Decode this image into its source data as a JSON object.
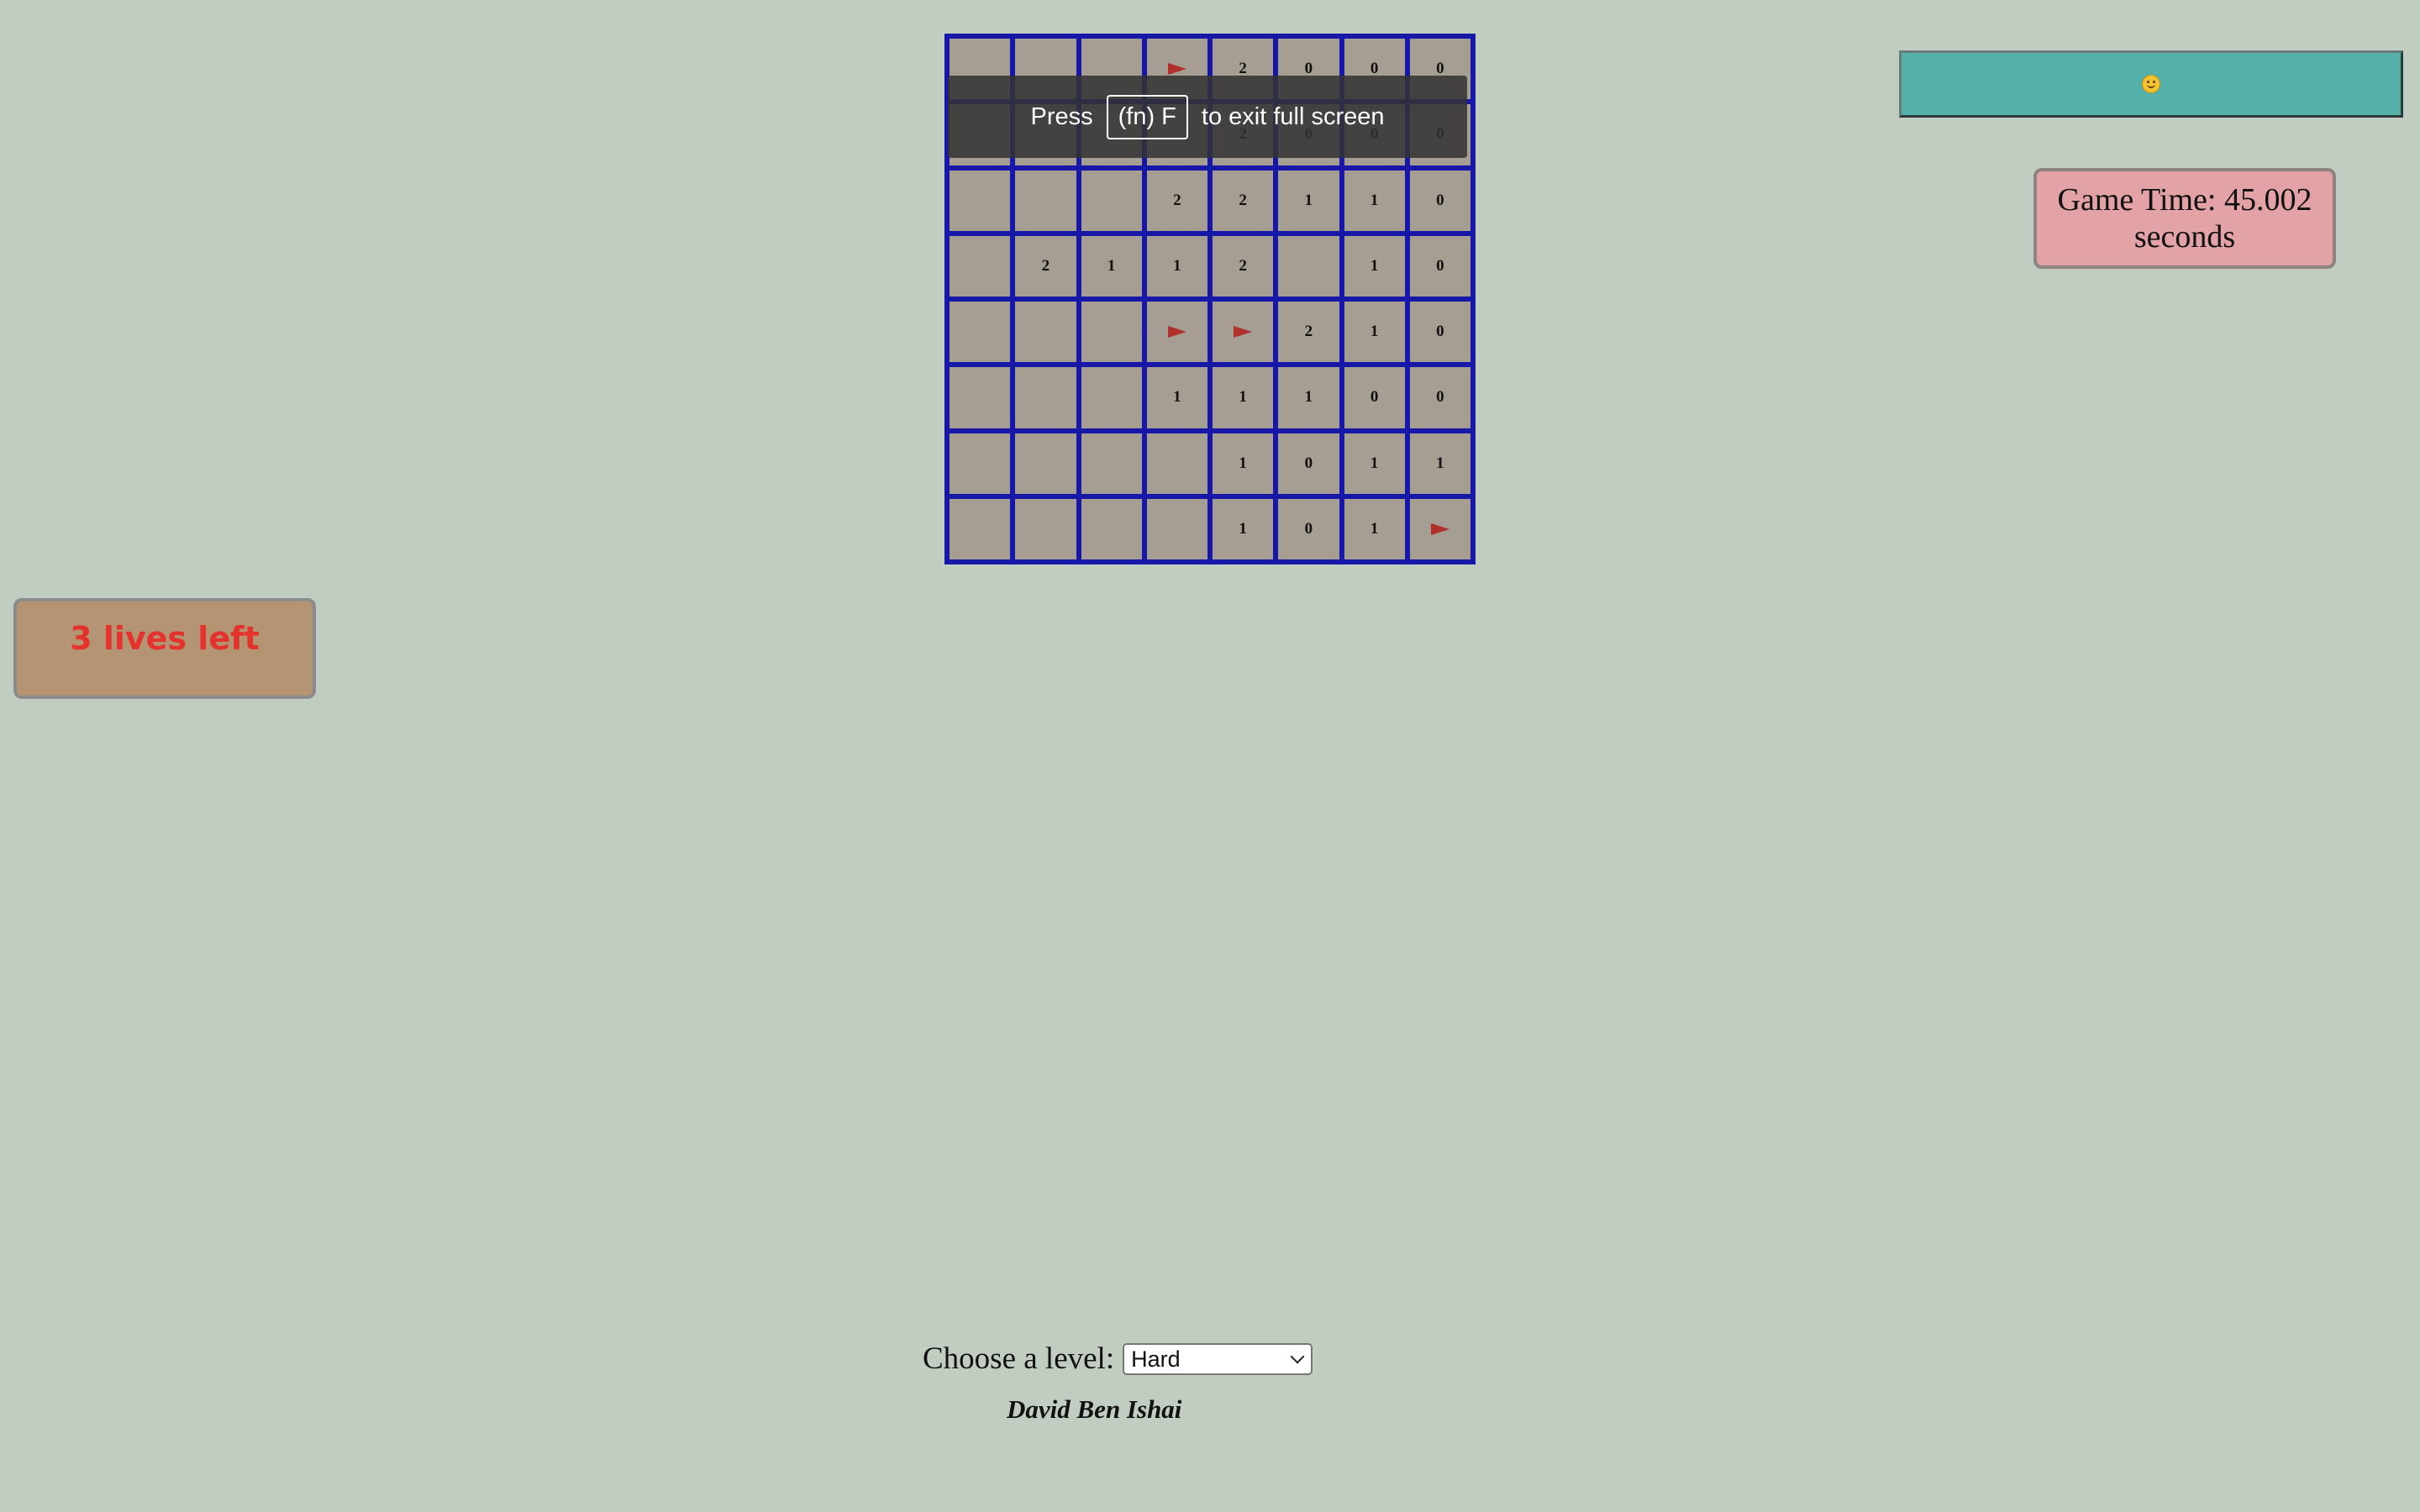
{
  "board": {
    "rows": [
      [
        "",
        "",
        "",
        "flag",
        "2",
        "0",
        "0",
        "0"
      ],
      [
        "",
        "",
        "",
        "",
        "2",
        "0",
        "0",
        "0"
      ],
      [
        "",
        "",
        "",
        "2",
        "2",
        "1",
        "1",
        "0"
      ],
      [
        "",
        "2",
        "1",
        "1",
        "2",
        "",
        "1",
        "0"
      ],
      [
        "",
        "",
        "",
        "flag",
        "flag",
        "2",
        "1",
        "0"
      ],
      [
        "",
        "",
        "",
        "1",
        "1",
        "1",
        "0",
        "0"
      ],
      [
        "",
        "",
        "",
        "",
        "1",
        "0",
        "1",
        "1"
      ],
      [
        "",
        "",
        "",
        "",
        "1",
        "0",
        "1",
        "flag"
      ]
    ]
  },
  "fullscreen_notice": {
    "press": "Press",
    "key": "(fn) F",
    "rest": "to exit full screen"
  },
  "reset_button": {
    "icon": "smiley-face-icon"
  },
  "timer": {
    "text": "Game Time: 45.002 seconds"
  },
  "lives": {
    "text": "3 lives left"
  },
  "level": {
    "label": "Choose a level:",
    "selected": "Hard"
  },
  "author": "David Ben Ishai",
  "colors": {
    "background": "#c2cdc2",
    "grid": "#1717a8",
    "cell": "#a69d93",
    "flag": "#b0302a",
    "reset_button": "#56b0aa",
    "timer": "#e2a2a6",
    "lives_box": "#b59473",
    "lives_text": "#e3332c"
  }
}
